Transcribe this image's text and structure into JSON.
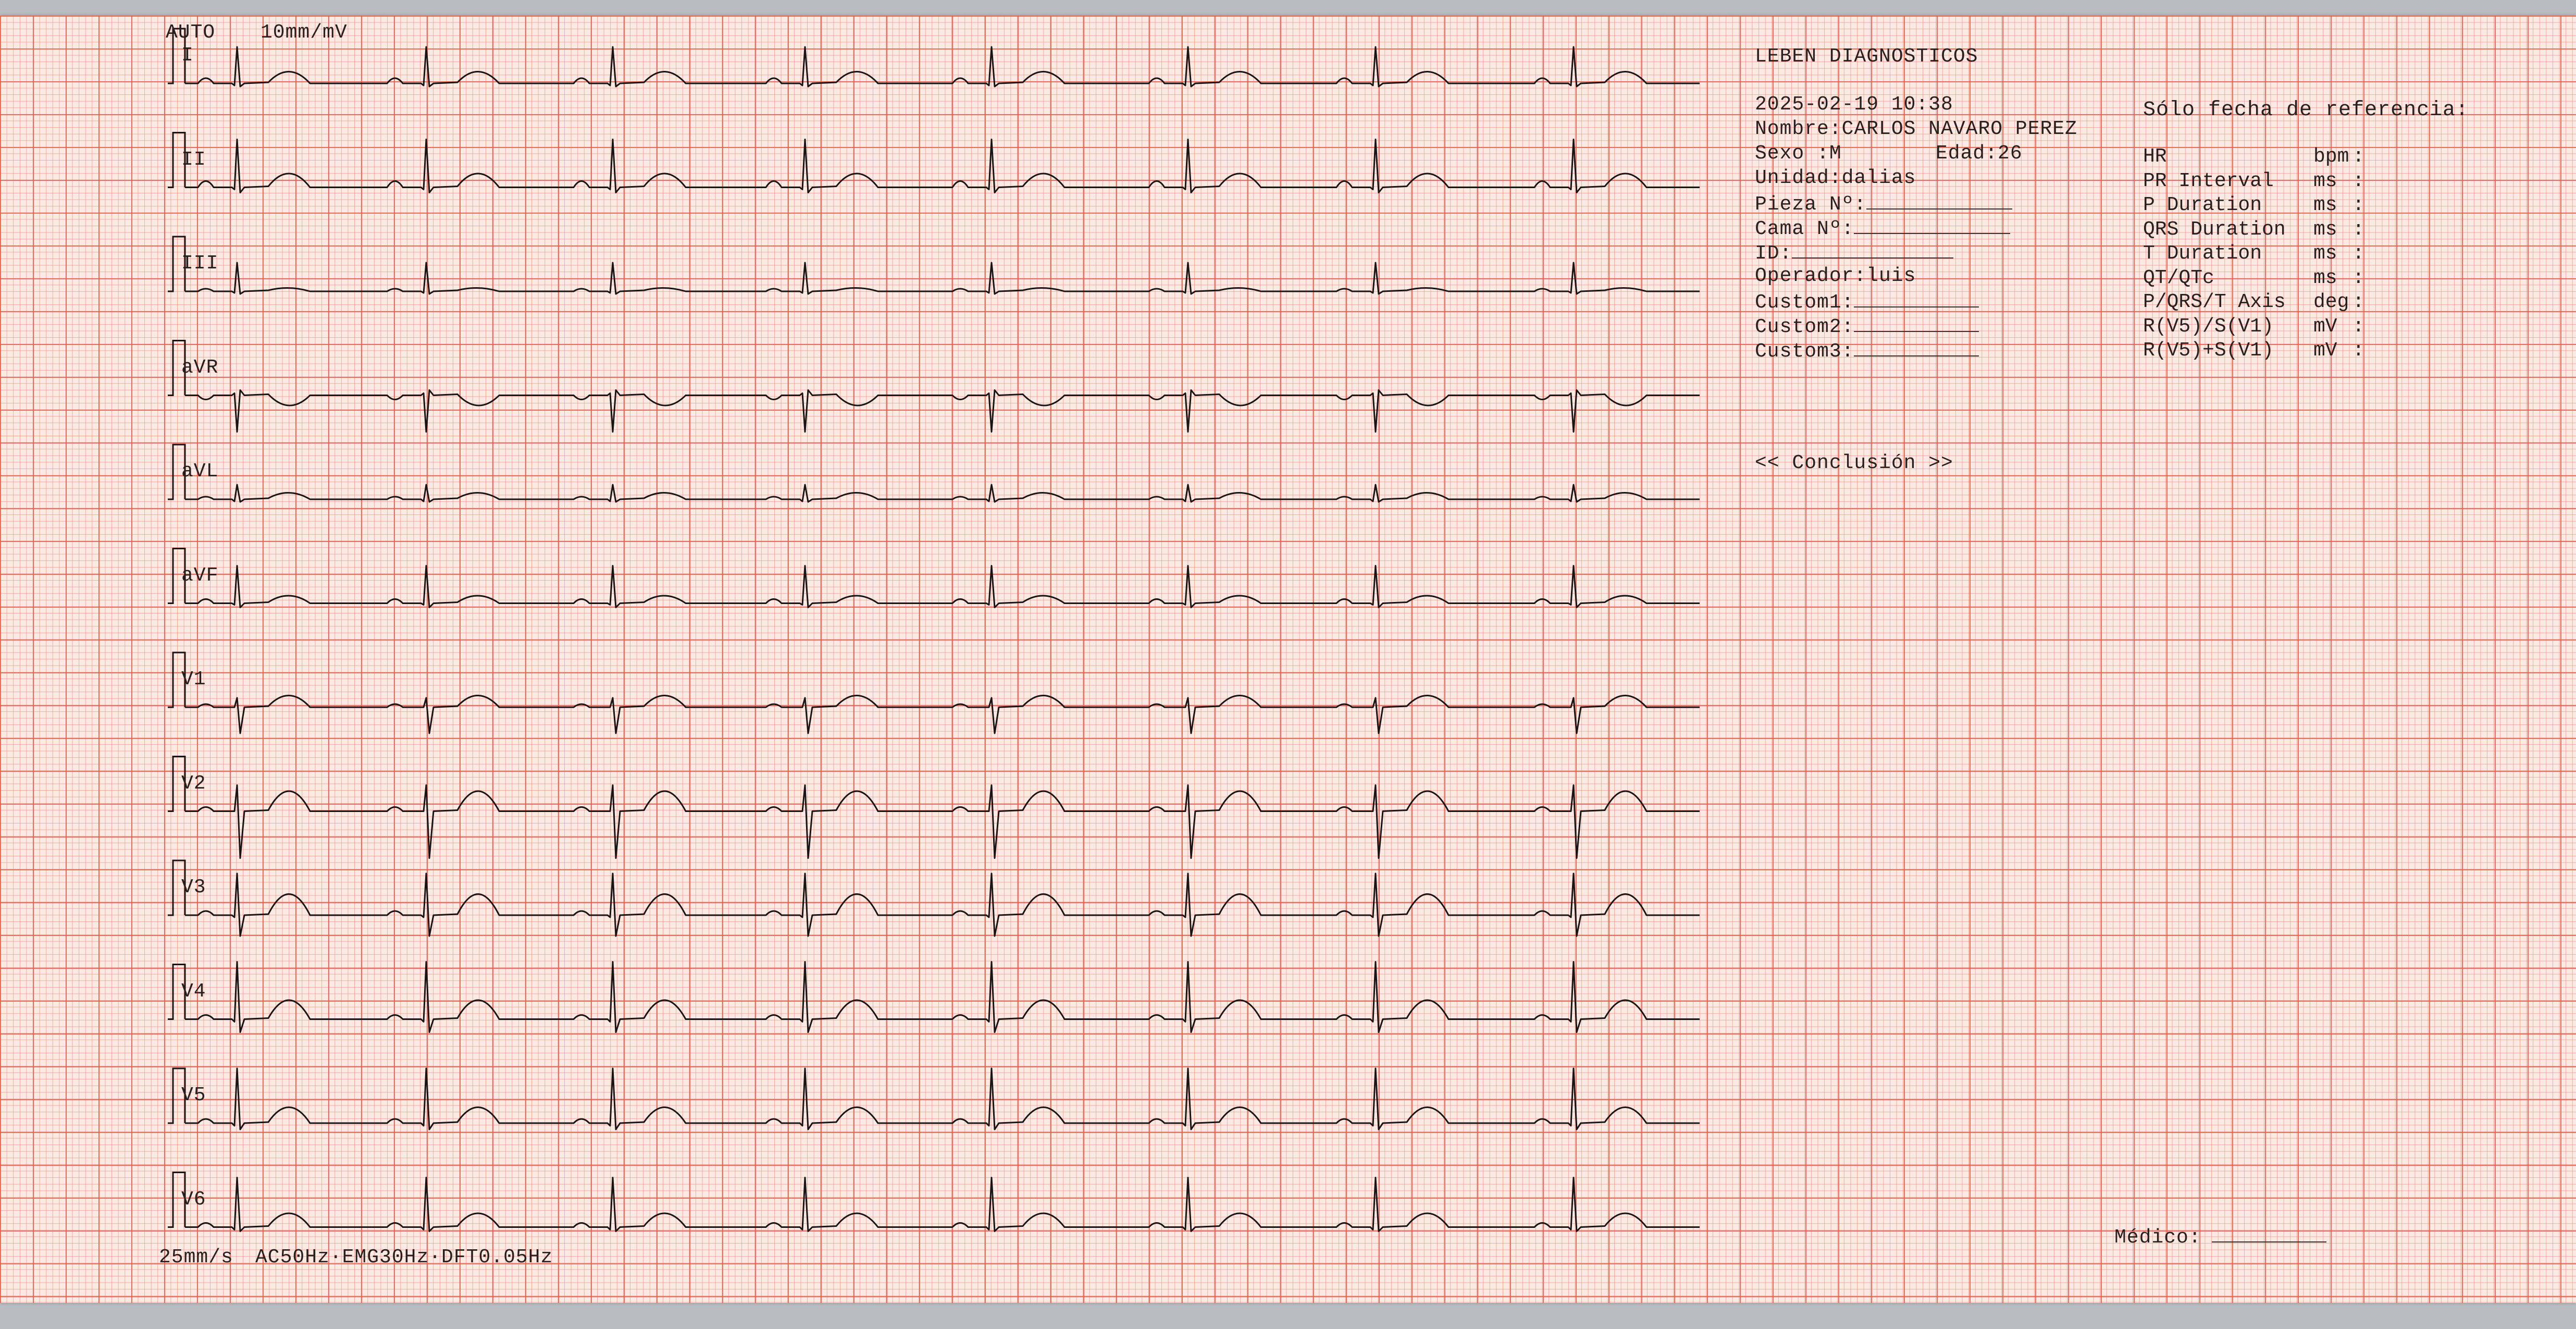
{
  "header": {
    "mode": "AUTO",
    "gain": "10mm/mV"
  },
  "leads": [
    "I",
    "II",
    "III",
    "aVR",
    "aVL",
    "aVF",
    "V1",
    "V2",
    "V3",
    "V4",
    "V5",
    "V6"
  ],
  "footer": {
    "speed": "25mm/s",
    "filters": "AC50Hz·EMG30Hz·DFT0.05Hz"
  },
  "patient": {
    "institution": "LEBEN DIAGNOSTICOS",
    "datetime": "2025-02-19 10:38",
    "name_label": "Nombre:",
    "name_value": "CARLOS NAVARO PEREZ",
    "sex_label": "Sexo  :",
    "sex_value": "M",
    "age_label": "Edad:",
    "age_value": "26",
    "unit_label": "Unidad:",
    "unit_value": "dalias",
    "room_label": "Pieza Nº:",
    "bed_label": "Cama Nº:",
    "id_label": "ID:",
    "operator_label": "Operador:",
    "operator_value": "luis",
    "custom1_label": "Custom1:",
    "custom2_label": "Custom2:",
    "custom3_label": "Custom3:"
  },
  "measurements": {
    "title": "Sólo fecha de referencia:",
    "rows": [
      {
        "label": "HR",
        "unit": "bpm"
      },
      {
        "label": "PR Interval",
        "unit": "ms"
      },
      {
        "label": "P Duration",
        "unit": "ms"
      },
      {
        "label": "QRS Duration",
        "unit": "ms"
      },
      {
        "label": "T Duration",
        "unit": "ms"
      },
      {
        "label": "QT/QTc",
        "unit": "ms"
      },
      {
        "label": "P/QRS/T Axis",
        "unit": "deg"
      },
      {
        "label": "R(V5)/S(V1)",
        "unit": "mV"
      },
      {
        "label": "R(V5)+S(V1)",
        "unit": "mV"
      }
    ]
  },
  "conclusion": {
    "title": "<< Conclusión >>"
  },
  "signature": {
    "label": "Médico:"
  },
  "colors": {
    "grid_major": "#e85d4b",
    "grid_minor": "#ec7864",
    "paper": "#fbe9e4",
    "trace": "#1a1414"
  }
}
